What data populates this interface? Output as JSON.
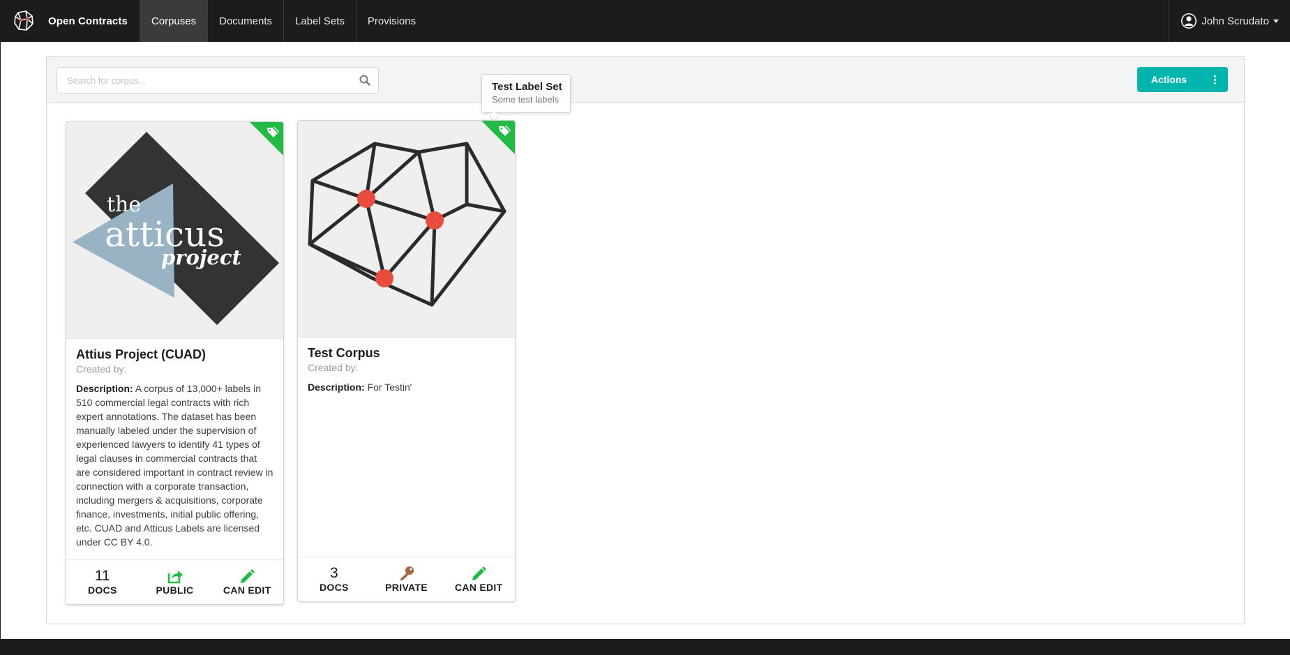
{
  "navbar": {
    "brand": "Open Contracts",
    "items": [
      {
        "label": "Corpuses",
        "active": true
      },
      {
        "label": "Documents",
        "active": false
      },
      {
        "label": "Label Sets",
        "active": false
      },
      {
        "label": "Provisions",
        "active": false
      }
    ],
    "user_name": "John Scrudato"
  },
  "toolbar": {
    "search_placeholder": "Search for corpus...",
    "actions_label": "Actions"
  },
  "tooltip": {
    "title": "Test Label Set",
    "subtitle": "Some test labels"
  },
  "cards": [
    {
      "title": "Attius Project (CUAD)",
      "created_by": "Created by:",
      "description_label": "Description:",
      "description": "A corpus of 13,000+ labels in 510 commercial legal contracts with rich expert annotations. The dataset has been manually labeled under the supervision of experienced lawyers to identify 41 types of legal clauses in commercial contracts that are considered important in contract review in connection with a corporate transaction, including mergers & acquisitions, corporate finance, investments, initial public offering, etc. CUAD and Atticus Labels are licensed under CC BY 4.0.",
      "image_text": {
        "line1": "the",
        "line2": "atticus",
        "line3": "project"
      },
      "docs_count": "11",
      "docs_label": "DOCS",
      "visibility_label": "PUBLIC",
      "visibility_icon": "share-icon",
      "edit_label": "CAN EDIT",
      "edit_icon": "pencil-icon"
    },
    {
      "title": "Test Corpus",
      "created_by": "Created by:",
      "description_label": "Description:",
      "description": "For Testin'",
      "docs_count": "3",
      "docs_label": "DOCS",
      "visibility_label": "PRIVATE",
      "visibility_icon": "key-icon",
      "edit_label": "CAN EDIT",
      "edit_icon": "pencil-icon"
    }
  ],
  "colors": {
    "navbar": "#1b1c1d",
    "accent_teal": "#00b5ad",
    "tag_green": "#21ba45",
    "key_brown": "#a5673f",
    "node_red": "#e74c3c"
  }
}
